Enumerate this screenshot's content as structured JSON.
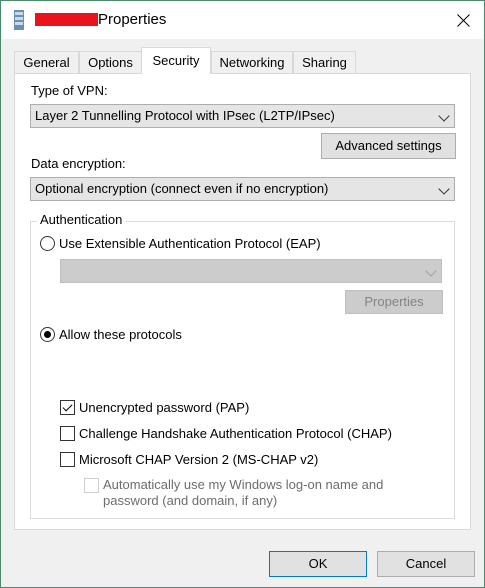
{
  "window": {
    "title": "Properties",
    "close_label": "Close"
  },
  "tabs": [
    {
      "label": "General"
    },
    {
      "label": "Options"
    },
    {
      "label": "Security"
    },
    {
      "label": "Networking"
    },
    {
      "label": "Sharing"
    }
  ],
  "security": {
    "vpn_type_label": "Type of VPN:",
    "vpn_type_value": "Layer 2 Tunnelling Protocol with IPsec (L2TP/IPsec)",
    "advanced_settings_label": "Advanced settings",
    "data_encryption_label": "Data encryption:",
    "data_encryption_value": "Optional encryption (connect even if no encryption)",
    "authentication": {
      "group_label": "Authentication",
      "eap_radio_label": "Use Extensible Authentication Protocol (EAP)",
      "eap_selected": false,
      "eap_combo_value": "",
      "eap_properties_label": "Properties",
      "allow_protocols_label": "Allow these protocols",
      "allow_protocols_selected": true,
      "protocols": [
        {
          "label": "Unencrypted password (PAP)",
          "checked": true
        },
        {
          "label": "Challenge Handshake Authentication Protocol (CHAP)",
          "checked": false
        },
        {
          "label": "Microsoft CHAP Version 2 (MS-CHAP v2)",
          "checked": false
        }
      ],
      "auto_logon_line1": "Automatically use my Windows log-on name and",
      "auto_logon_line2": "password (and domain, if any)",
      "auto_logon_checked": false
    }
  },
  "footer": {
    "ok_label": "OK",
    "cancel_label": "Cancel"
  },
  "colors": {
    "title_redaction": "#e8141c",
    "window_border": "#4a8a6a"
  }
}
